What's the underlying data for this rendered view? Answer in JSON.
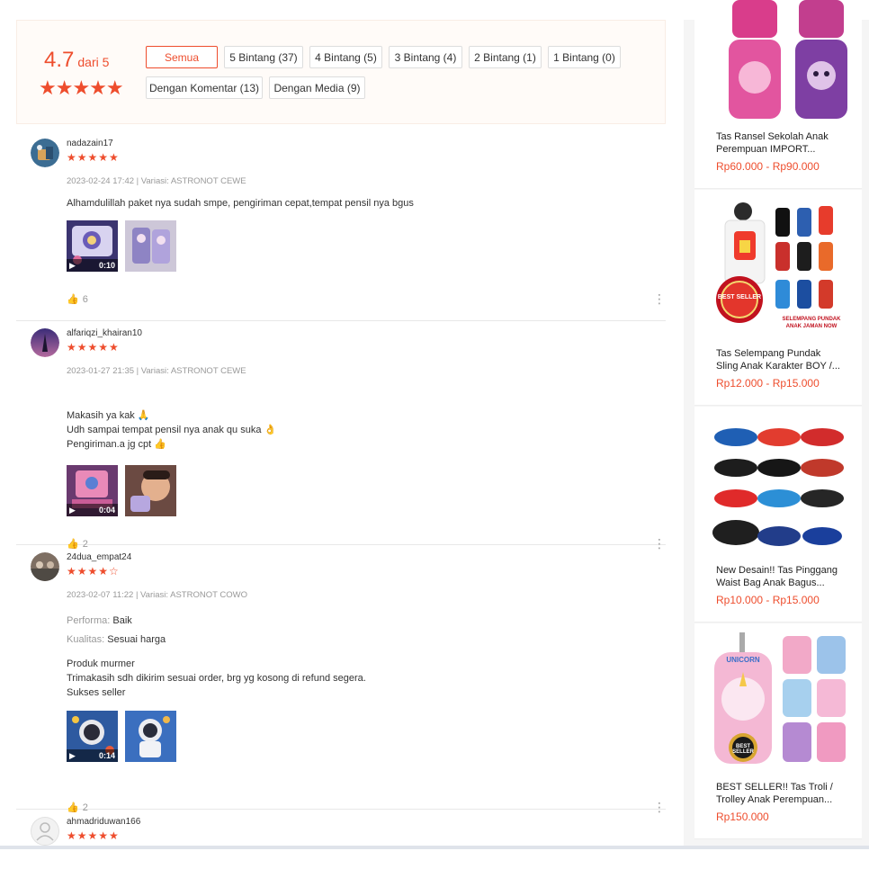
{
  "summary": {
    "score": "4.7",
    "out_of": "dari 5",
    "stars": "★★★★★",
    "filters": [
      {
        "label": "Semua",
        "active": true
      },
      {
        "label": "5 Bintang (37)"
      },
      {
        "label": "4 Bintang (5)"
      },
      {
        "label": "3 Bintang (4)"
      },
      {
        "label": "2 Bintang (1)"
      },
      {
        "label": "1 Bintang (0)"
      },
      {
        "label": "Dengan Komentar (13)"
      },
      {
        "label": "Dengan Media (9)"
      }
    ]
  },
  "reviews": [
    {
      "username": "nadazain17",
      "stars": "★★★★★",
      "meta": "2023-02-24 17:42 | Variasi: ASTRONOT CEWE",
      "comment": "Alhamdulillah paket nya sudah smpe, pengiriman cepat,tempat pensil nya bgus",
      "video_time": "0:10",
      "likes": "6"
    },
    {
      "username": "alfariqzi_khairan10",
      "stars": "★★★★★",
      "meta": "2023-01-27 21:35 | Variasi: ASTRONOT CEWE",
      "comment_lines": [
        "Makasih ya kak 🙏",
        "Udh sampai tempat pensil nya anak qu suka 👌",
        "Pengiriman.a jg cpt 👍"
      ],
      "video_time": "0:04",
      "likes": "2"
    },
    {
      "username": "24dua_empat24",
      "stars": "★★★★☆",
      "meta": "2023-02-07 11:22 | Variasi: ASTRONOT COWO",
      "performa_key": "Performa:",
      "performa_val": "Baik",
      "kualitas_key": "Kualitas:",
      "kualitas_val": "Sesuai harga",
      "comment_lines": [
        "Produk murmer",
        "Trimakasih sdh dikirim sesuai order, brg yg kosong di refund segera.",
        "Sukses seller"
      ],
      "video_time": "0:14",
      "likes": "2"
    },
    {
      "username": "ahmadriduwan166",
      "stars": "★★★★★"
    }
  ],
  "sidebar": {
    "products": [
      {
        "name": "Tas Ransel Sekolah Anak Perempuan IMPORT...",
        "price": "Rp60.000 - Rp90.000"
      },
      {
        "name": "Tas Selempang Pundak Sling Anak Karakter BOY /...",
        "price": "Rp12.000 - Rp15.000",
        "badge": "BEST SELLER",
        "caption": "SELEMPANG PUNDAK ANAK JAMAN NOW"
      },
      {
        "name": "New Desain!! Tas Pinggang Waist Bag Anak Bagus...",
        "price": "Rp10.000 - Rp15.000"
      },
      {
        "name": "BEST SELLER!! Tas Troli / Trolley Anak Perempuan...",
        "price": "Rp150.000",
        "badge": "BEST SELLER",
        "logo": "UNICORN"
      }
    ]
  },
  "colors": {
    "accent": "#ee4d2d"
  }
}
